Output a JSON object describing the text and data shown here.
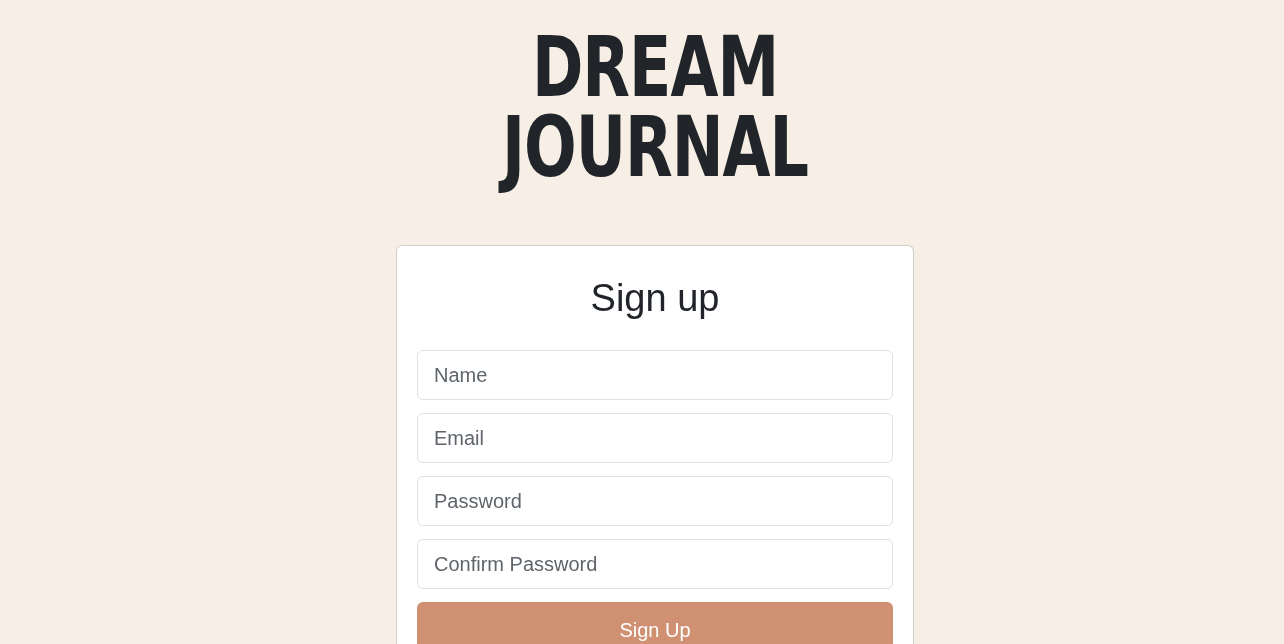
{
  "logo": {
    "lines": [
      "DREAM",
      "JOURNAL"
    ]
  },
  "form": {
    "title": "Sign up",
    "fields": [
      {
        "placeholder": "Name"
      },
      {
        "placeholder": "Email"
      },
      {
        "placeholder": "Password"
      },
      {
        "placeholder": "Confirm Password"
      }
    ],
    "submit": "Sign Up"
  }
}
